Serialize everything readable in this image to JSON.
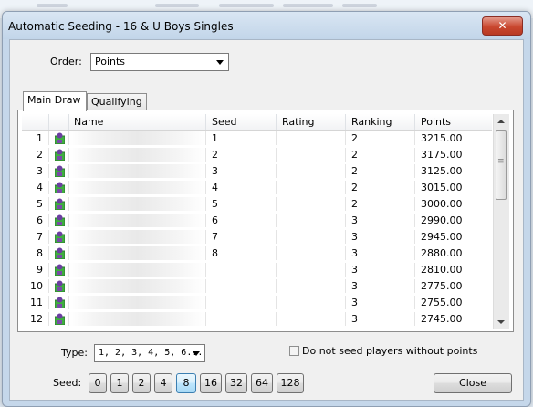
{
  "dialog": {
    "title": "Automatic Seeding - 16 & U Boys Singles",
    "close_glyph": "✕"
  },
  "order": {
    "label": "Order:",
    "value": "Points"
  },
  "tabs": [
    {
      "label": "Main Draw",
      "active": true
    },
    {
      "label": "Qualifying",
      "active": false
    }
  ],
  "table": {
    "columns": {
      "name": "Name",
      "seed": "Seed",
      "rating": "Rating",
      "ranking": "Ranking",
      "points": "Points"
    },
    "rows": [
      {
        "num": "1",
        "seed": "1",
        "rating": "",
        "ranking": "2",
        "points": "3215.00"
      },
      {
        "num": "2",
        "seed": "2",
        "rating": "",
        "ranking": "2",
        "points": "3175.00"
      },
      {
        "num": "3",
        "seed": "3",
        "rating": "",
        "ranking": "2",
        "points": "3125.00"
      },
      {
        "num": "4",
        "seed": "4",
        "rating": "",
        "ranking": "2",
        "points": "3015.00"
      },
      {
        "num": "5",
        "seed": "5",
        "rating": "",
        "ranking": "2",
        "points": "3000.00"
      },
      {
        "num": "6",
        "seed": "6",
        "rating": "",
        "ranking": "3",
        "points": "2990.00"
      },
      {
        "num": "7",
        "seed": "7",
        "rating": "",
        "ranking": "3",
        "points": "2945.00"
      },
      {
        "num": "8",
        "seed": "8",
        "rating": "",
        "ranking": "3",
        "points": "2880.00"
      },
      {
        "num": "9",
        "seed": "",
        "rating": "",
        "ranking": "3",
        "points": "2810.00"
      },
      {
        "num": "10",
        "seed": "",
        "rating": "",
        "ranking": "3",
        "points": "2775.00"
      },
      {
        "num": "11",
        "seed": "",
        "rating": "",
        "ranking": "3",
        "points": "2755.00"
      },
      {
        "num": "12",
        "seed": "",
        "rating": "",
        "ranking": "3",
        "points": "2745.00"
      }
    ]
  },
  "type": {
    "label": "Type:",
    "value": "1, 2, 3, 4, 5, 6..."
  },
  "no_seed_checkbox": {
    "label": "Do not seed players without points",
    "checked": false
  },
  "seed": {
    "label": "Seed:",
    "options": [
      "0",
      "1",
      "2",
      "4",
      "8",
      "16",
      "32",
      "64",
      "128"
    ],
    "selected": "8"
  },
  "close_button": {
    "label": "Close"
  },
  "colors": {
    "selected_button": "#bee6fd",
    "close_red": "#c9472f",
    "player_icon_green": "#3fae3f"
  }
}
